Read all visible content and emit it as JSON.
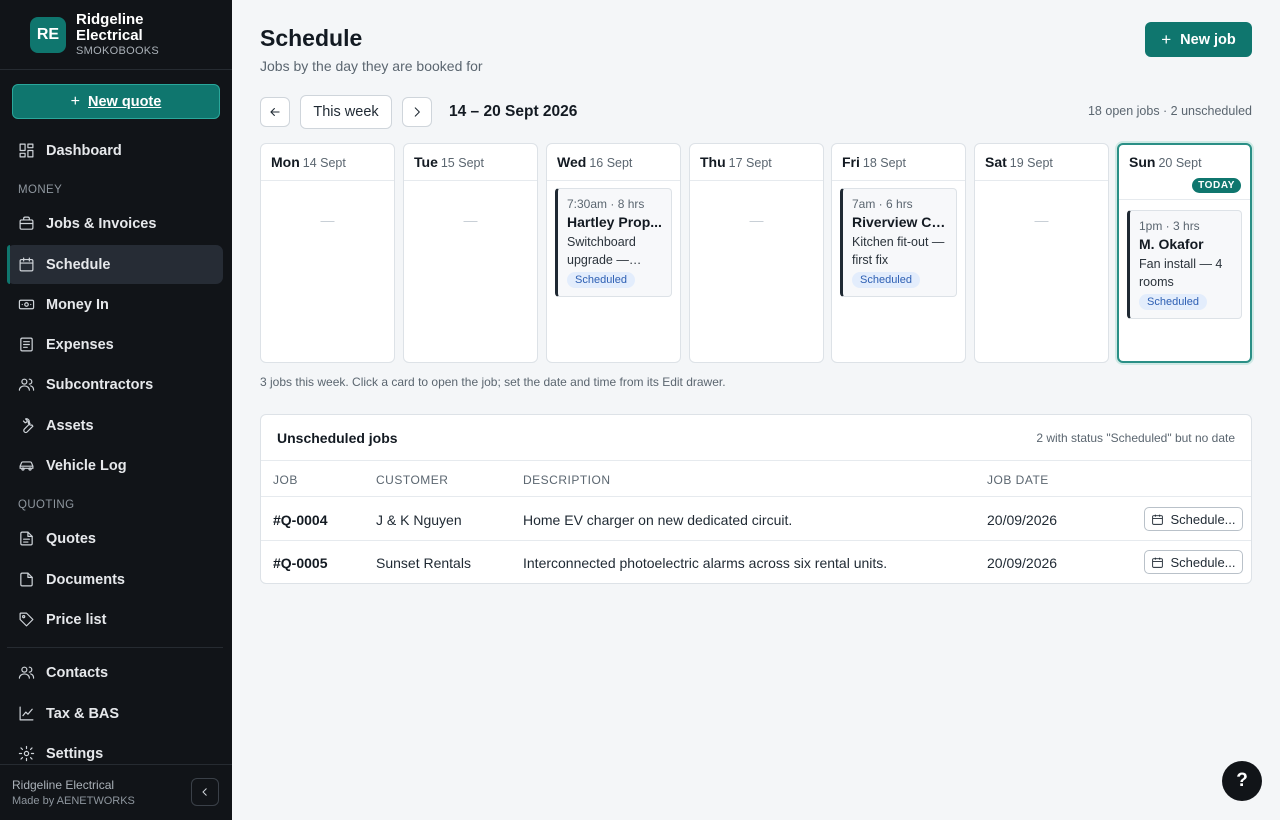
{
  "brand": {
    "initials": "RE",
    "name": "Ridgeline Electrical",
    "subtitle": "SMOKOBOOKS"
  },
  "sidebar": {
    "new_quote": {
      "plus": "+",
      "label": "New quote"
    },
    "dashboard": "Dashboard",
    "sections": {
      "money": "MONEY",
      "quoting": "QUOTING"
    },
    "items": {
      "jobs_invoices": "Jobs & Invoices",
      "schedule": "Schedule",
      "money_in": "Money In",
      "expenses": "Expenses",
      "subcontractors": "Subcontractors",
      "assets": "Assets",
      "vehicle_log": "Vehicle Log",
      "quotes": "Quotes",
      "documents": "Documents",
      "price_list": "Price list",
      "contacts": "Contacts",
      "tax_bas": "Tax & BAS",
      "settings": "Settings"
    },
    "active": "schedule",
    "footer": {
      "company": "Ridgeline Electrical",
      "made_by": "Made by AENETWORKS"
    }
  },
  "header": {
    "title": "Schedule",
    "subtitle": "Jobs by the day they are booked for",
    "new_job": {
      "plus": "+",
      "label": "New job"
    }
  },
  "week_nav": {
    "this_week": "This week",
    "range": "14 – 20 Sept 2026",
    "summary": "18 open jobs · 2 unscheduled"
  },
  "days": [
    {
      "name": "Mon",
      "date": "14 Sept",
      "empty": "—"
    },
    {
      "name": "Tue",
      "date": "15 Sept",
      "empty": "—"
    },
    {
      "name": "Wed",
      "date": "16 Sept",
      "job": {
        "time": "7:30am · 8 hrs",
        "customer": "Hartley Prop...",
        "description": "Switchboard upgrade — unit...",
        "status": "Scheduled"
      }
    },
    {
      "name": "Thu",
      "date": "17 Sept",
      "empty": "—"
    },
    {
      "name": "Fri",
      "date": "18 Sept",
      "job": {
        "time": "7am · 6 hrs",
        "customer": "Riverview Cafe",
        "description": "Kitchen fit-out — first fix",
        "status": "Scheduled"
      }
    },
    {
      "name": "Sat",
      "date": "19 Sept",
      "empty": "—"
    },
    {
      "name": "Sun",
      "date": "20 Sept",
      "today": "TODAY",
      "job": {
        "time": "1pm · 3 hrs",
        "customer": "M. Okafor",
        "description": "Fan install — 4 rooms",
        "status": "Scheduled"
      }
    }
  ],
  "hint": "3 jobs this week. Click a card to open the job; set the date and time from its Edit drawer.",
  "unscheduled": {
    "title": "Unscheduled jobs",
    "note": "2 with status \"Scheduled\" but no date",
    "columns": [
      "JOB",
      "CUSTOMER",
      "DESCRIPTION",
      "JOB DATE"
    ],
    "rows": [
      {
        "job": "#Q-0004",
        "customer": "J & K Nguyen",
        "description": "Home EV charger on new dedicated circuit.",
        "date": "20/09/2026",
        "action": "Schedule..."
      },
      {
        "job": "#Q-0005",
        "customer": "Sunset Rentals",
        "description": "Interconnected photoelectric alarms across six rental units.",
        "date": "20/09/2026",
        "action": "Schedule..."
      }
    ]
  },
  "help": "?",
  "colors": {
    "accent": "#0f766e",
    "sidebar_bg": "#111418",
    "badge_bg": "#e3edfc",
    "badge_text": "#2d5fb3"
  }
}
